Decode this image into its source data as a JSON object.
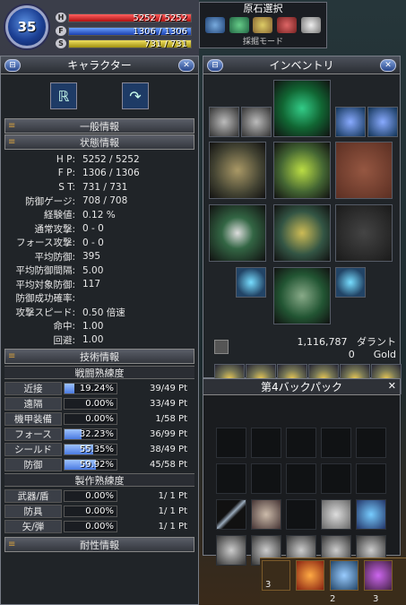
{
  "status": {
    "level": "35",
    "hp_tag": "H",
    "fp_tag": "F",
    "st_tag": "S",
    "hp": "5252 / 5252",
    "fp": "1306 / 1306",
    "st": "731 / 731"
  },
  "ore": {
    "title": "原石選択",
    "footer": "採掘モード"
  },
  "character": {
    "title": "キャラクター",
    "general_header": "一般情報",
    "status_header": "状態情報",
    "stats": [
      {
        "label": "H P:",
        "value": "5252 / 5252"
      },
      {
        "label": "F P:",
        "value": "1306 / 1306"
      },
      {
        "label": "S T:",
        "value": "731 / 731"
      },
      {
        "label": "防御ゲージ:",
        "value": "708 / 708"
      },
      {
        "label": "経験値:",
        "value": "0.12 %"
      },
      {
        "label": "通常攻撃:",
        "value": "0 - 0"
      },
      {
        "label": "フォース攻撃:",
        "value": "0 - 0"
      },
      {
        "label": "平均防御:",
        "value": "395"
      },
      {
        "label": "平均防御間隔:",
        "value": "5.00"
      },
      {
        "label": "平均対象防御:",
        "value": "117"
      },
      {
        "label": "防御成功確率:",
        "value": ""
      },
      {
        "label": "攻撃スピード:",
        "value": "0.50 倍速"
      },
      {
        "label": "命中:",
        "value": "1.00"
      },
      {
        "label": "回避:",
        "value": "1.00"
      }
    ],
    "skill_header": "技術情報",
    "combat_header": "戦闘熟練度",
    "combat": [
      {
        "label": "近接",
        "pct": "19.24%",
        "fill": 0.1924,
        "pt": "39/49 Pt"
      },
      {
        "label": "遠隔",
        "pct": "0.00%",
        "fill": 0,
        "pt": "33/49 Pt"
      },
      {
        "label": "機甲装備",
        "pct": "0.00%",
        "fill": 0,
        "pt": "1/58 Pt"
      },
      {
        "label": "フォース",
        "pct": "32.23%",
        "fill": 0.3223,
        "pt": "36/99 Pt"
      },
      {
        "label": "シールド",
        "pct": "55.35%",
        "fill": 0.5535,
        "pt": "38/49 Pt"
      },
      {
        "label": "防御",
        "pct": "59.92%",
        "fill": 0.5992,
        "pt": "45/58 Pt"
      }
    ],
    "craft_header": "製作熟練度",
    "craft": [
      {
        "label": "武器/盾",
        "pct": "0.00%",
        "fill": 0,
        "pt": "1/ 1 Pt"
      },
      {
        "label": "防具",
        "pct": "0.00%",
        "fill": 0,
        "pt": "1/ 1 Pt"
      },
      {
        "label": "矢/弾",
        "pct": "0.00%",
        "fill": 0,
        "pt": "1/ 1 Pt"
      }
    ],
    "durability_header": "耐性情報"
  },
  "inventory": {
    "title": "インベントリ",
    "dalant": "1,116,787",
    "dalant_unit": "ダラント",
    "gold": "0",
    "gold_unit": "Gold"
  },
  "backpack": {
    "title": "第4バックパック",
    "close": "✕"
  },
  "hotbar": {
    "slot3": "3",
    "key2": "2",
    "key3": "3"
  }
}
